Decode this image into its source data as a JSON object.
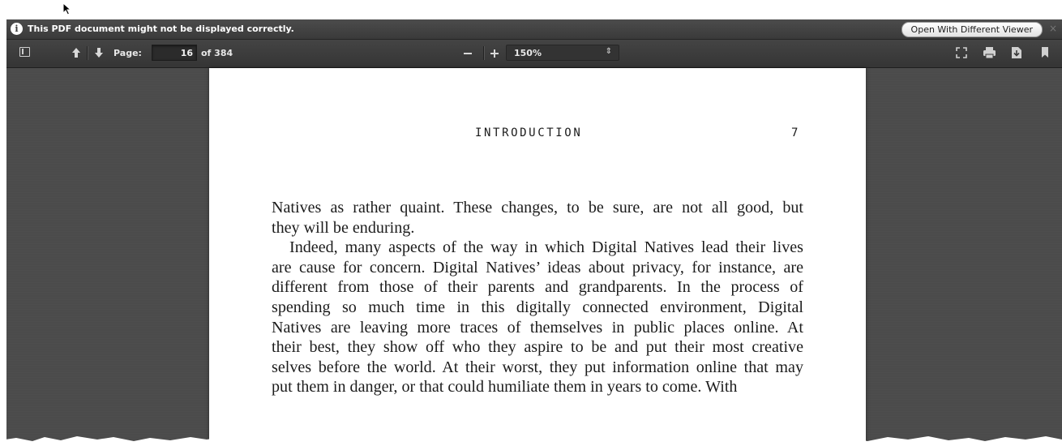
{
  "notification": {
    "message": "This PDF document might not be displayed correctly.",
    "info_icon": "info-icon",
    "open_viewer_label": "Open With Different Viewer",
    "close_glyph": "×"
  },
  "toolbar": {
    "page_label": "Page:",
    "current_page": "16",
    "page_count": "of 384",
    "zoom_value": "150%",
    "icons": [
      "sidebar-toggle-icon",
      "arrow-up-icon",
      "arrow-down-icon",
      "zoom-out-icon",
      "zoom-in-icon",
      "fullscreen-icon",
      "print-icon",
      "download-icon",
      "bookmark-icon"
    ]
  },
  "document": {
    "running_head": "INTRODUCTION",
    "page_number": "7",
    "lines": [
      "Natives as rather quaint. These changes, to be sure, are not all good, but",
      "they will be enduring.",
      "Indeed, many aspects of the way in which Digital Natives lead their lives",
      "are cause for concern. Digital Natives’ ideas about privacy, for instance, are",
      "different from those of their parents and grandparents. In the process of",
      "spending so much time in this digitally connected environment, Digital",
      "Natives are leaving more traces of themselves in public places online. At",
      "their best, they show off who they aspire to be and put their most creative",
      "selves before the world. At their worst, they put information online that may",
      "put them in danger, or that could humiliate them in years to come. With"
    ]
  },
  "colors": {
    "toolbar": "#3d3d3d",
    "viewer_background": "#4b4b4b",
    "page": "#ffffff"
  }
}
